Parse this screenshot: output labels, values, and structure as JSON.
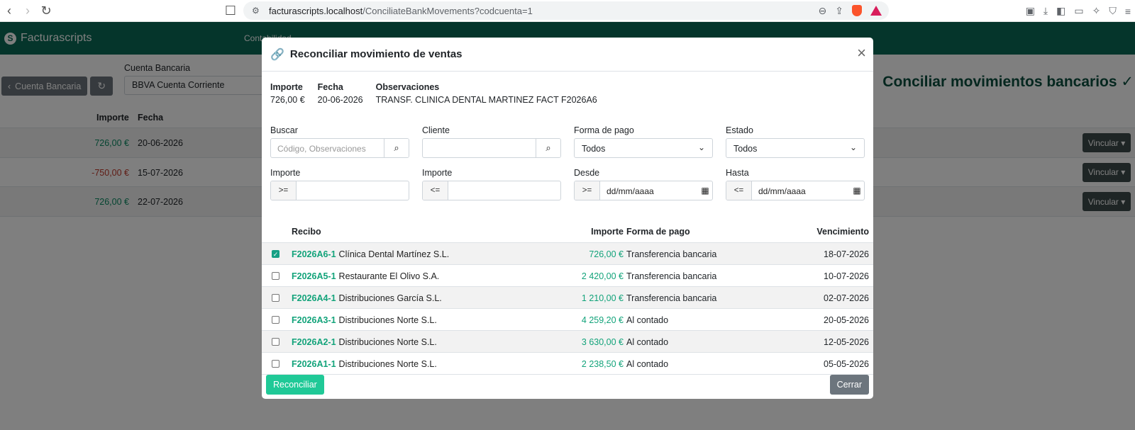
{
  "browser": {
    "url_host": "facturascripts.localhost",
    "url_path": "/ConciliateBankMovements?codcuenta=1"
  },
  "app": {
    "brand": "Facturascripts",
    "nav_link": "Contabilidad",
    "back_button": "Cuenta Bancaria",
    "account_label": "Cuenta Bancaria",
    "account_value": "BBVA Cuenta Corriente",
    "heading": "Conciliar movimientos bancarios ✓",
    "table_head": {
      "importe": "Importe",
      "fecha": "Fecha"
    },
    "rows": [
      {
        "amount": "726,00 €",
        "date": "20-06-2026",
        "action": "Vincular ▾"
      },
      {
        "amount": "-750,00 €",
        "date": "15-07-2026",
        "action": "Vincular ▾"
      },
      {
        "amount": "726,00 €",
        "date": "22-07-2026",
        "action": "Vincular ▾"
      }
    ]
  },
  "modal": {
    "title": "Reconciliar movimiento de ventas",
    "summary": {
      "importe_label": "Importe",
      "importe_value": "726,00 €",
      "fecha_label": "Fecha",
      "fecha_value": "20-06-2026",
      "obs_label": "Observaciones",
      "obs_value": "TRANSF. CLINICA DENTAL MARTINEZ FACT F2026A6"
    },
    "filters": {
      "buscar_label": "Buscar",
      "buscar_placeholder": "Código, Observaciones",
      "cliente_label": "Cliente",
      "forma_pago_label": "Forma de pago",
      "forma_pago_value": "Todos",
      "estado_label": "Estado",
      "estado_value": "Todos",
      "importe_min_label": "Importe",
      "importe_min_prefix": ">=",
      "importe_max_label": "Importe",
      "importe_max_prefix": "<=",
      "desde_label": "Desde",
      "desde_prefix": ">=",
      "desde_placeholder": "dd/mm/aaaa",
      "hasta_label": "Hasta",
      "hasta_prefix": "<=",
      "hasta_placeholder": "dd/mm/aaaa"
    },
    "columns": {
      "recibo": "Recibo",
      "importe": "Importe",
      "forma_pago": "Forma de pago",
      "vencimiento": "Vencimiento"
    },
    "receipts": [
      {
        "code": "F2026A6-1",
        "client": "Clínica Dental Martínez S.L.",
        "amount": "726,00 €",
        "payment": "Transferencia bancaria",
        "due": "18-07-2026",
        "checked": true
      },
      {
        "code": "F2026A5-1",
        "client": "Restaurante El Olivo S.A.",
        "amount": "2 420,00 €",
        "payment": "Transferencia bancaria",
        "due": "10-07-2026",
        "checked": false
      },
      {
        "code": "F2026A4-1",
        "client": "Distribuciones García S.L.",
        "amount": "1 210,00 €",
        "payment": "Transferencia bancaria",
        "due": "02-07-2026",
        "checked": false
      },
      {
        "code": "F2026A3-1",
        "client": "Distribuciones Norte S.L.",
        "amount": "4 259,20 €",
        "payment": "Al contado",
        "due": "20-05-2026",
        "checked": false
      },
      {
        "code": "F2026A2-1",
        "client": "Distribuciones Norte S.L.",
        "amount": "3 630,00 €",
        "payment": "Al contado",
        "due": "12-05-2026",
        "checked": false
      },
      {
        "code": "F2026A1-1",
        "client": "Distribuciones Norte S.L.",
        "amount": "2 238,50 €",
        "payment": "Al contado",
        "due": "05-05-2026",
        "checked": false
      }
    ],
    "reconciliar_button": "Reconciliar",
    "cerrar_button": "Cerrar"
  }
}
